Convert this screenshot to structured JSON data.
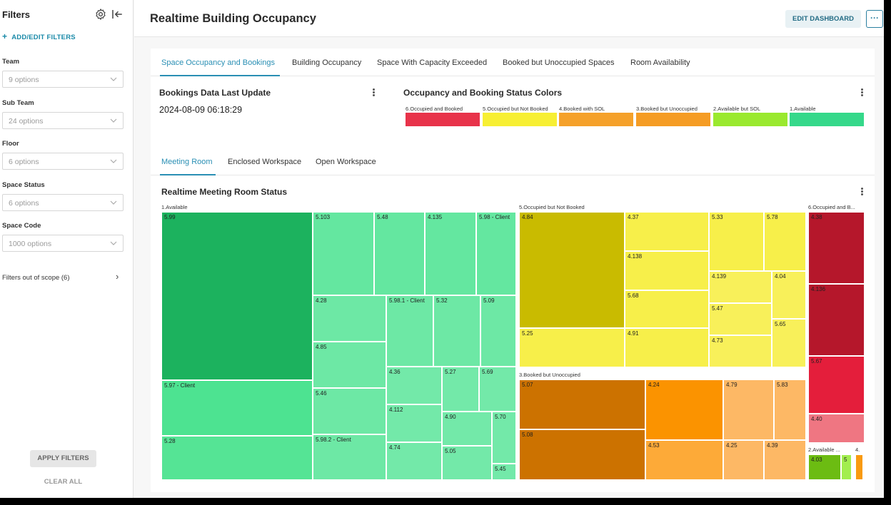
{
  "sidebar": {
    "title": "Filters",
    "add_filters": "ADD/EDIT FILTERS",
    "filters": [
      {
        "label": "Team",
        "placeholder": "9 options"
      },
      {
        "label": "Sub Team",
        "placeholder": "24 options"
      },
      {
        "label": "Floor",
        "placeholder": "6 options"
      },
      {
        "label": "Space Status",
        "placeholder": "6 options"
      },
      {
        "label": "Space Code",
        "placeholder": "1000 options"
      }
    ],
    "out_of_scope": "Filters out of scope (6)",
    "apply": "APPLY FILTERS",
    "clear": "CLEAR ALL"
  },
  "header": {
    "title": "Realtime Building Occupancy",
    "edit_button": "EDIT DASHBOARD",
    "more_button": "···"
  },
  "tabs": [
    {
      "label": "Space Occupancy and Bookings",
      "active": true
    },
    {
      "label": "Building Occupancy",
      "active": false
    },
    {
      "label": "Space With Capacity Exceeded",
      "active": false
    },
    {
      "label": "Booked but Unoccupied Spaces",
      "active": false
    },
    {
      "label": "Room Availability",
      "active": false
    }
  ],
  "bookings": {
    "title": "Bookings Data Last Update",
    "value": "2024-08-09 06:18:29"
  },
  "status_colors": {
    "title": "Occupancy and Booking Status Colors",
    "items": [
      {
        "label": "6.Occupied and Booked",
        "color": "#e8334a"
      },
      {
        "label": "5.Occupied but Not Booked",
        "color": "#f7ef33"
      },
      {
        "label": "4.Booked with SOL",
        "color": "#f5a12a"
      },
      {
        "label": "3.Booked but Unoccupied",
        "color": "#f59c24"
      },
      {
        "label": "2.Available but SOL",
        "color": "#9ae92e"
      },
      {
        "label": "1.Available",
        "color": "#35d88a"
      }
    ]
  },
  "subtabs": [
    {
      "label": "Meeting Room",
      "active": true
    },
    {
      "label": "Enclosed Workspace",
      "active": false
    },
    {
      "label": "Open Workspace",
      "active": false
    }
  ],
  "chart_data": {
    "type": "treemap",
    "title": "Realtime Meeting Room Status",
    "groups": [
      {
        "name": "1.Available",
        "cells": [
          "5.99",
          "5.97 - Client",
          "5.28",
          "5.103",
          "5.48",
          "4.135",
          "5.98 - Client",
          "4.28",
          "4.85",
          "5.46",
          "5.98.2 - Client",
          "5.98.1 - Client",
          "5.32",
          "5.09",
          "4.36",
          "5.27",
          "5.69",
          "4.112",
          "4.90",
          "5.70",
          "4.74",
          "5.05",
          "5.45"
        ]
      },
      {
        "name": "5.Occupied but Not Booked",
        "cells": [
          "4.84",
          "5.25",
          "4.37",
          "4.138",
          "5.68",
          "4.91",
          "5.33",
          "5.78",
          "4.139",
          "4.04",
          "5.47",
          "5.65",
          "4.73"
        ]
      },
      {
        "name": "3.Booked but Unoccupied",
        "cells": [
          "5.07",
          "5.08",
          "4.24",
          "4.53",
          "4.79",
          "5.83",
          "4.25",
          "4.39"
        ]
      },
      {
        "name": "6.Occupied and B...",
        "cells": [
          "4.38",
          "4.136",
          "5.67",
          "4.40"
        ]
      },
      {
        "name": "2.Available ...",
        "cells": [
          "4.03",
          "5"
        ]
      },
      {
        "name": "4.",
        "cells": [
          ""
        ]
      }
    ]
  }
}
